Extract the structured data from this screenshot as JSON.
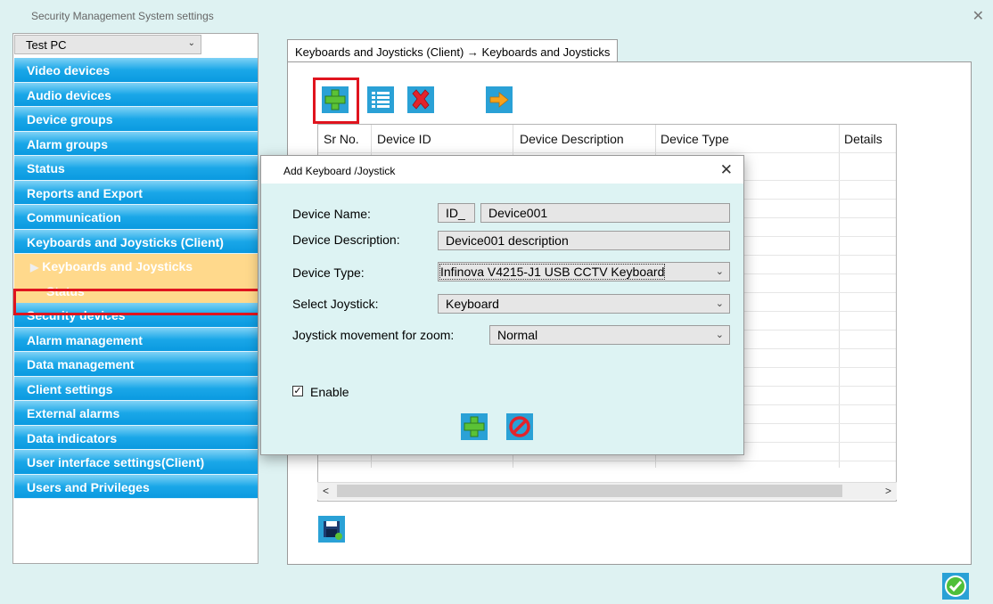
{
  "window": {
    "title": "Security Management System settings",
    "close_glyph": "✕"
  },
  "sidebar": {
    "pc_select": "Test PC",
    "items": [
      {
        "label": "Video devices"
      },
      {
        "label": "Audio devices"
      },
      {
        "label": "Device groups"
      },
      {
        "label": "Alarm groups"
      },
      {
        "label": "Status"
      },
      {
        "label": "Reports and Export"
      },
      {
        "label": "Communication"
      },
      {
        "label": "Keyboards and Joysticks (Client)"
      },
      {
        "label": "Keyboards and Joysticks"
      },
      {
        "label": "Status"
      },
      {
        "label": "Security devices"
      },
      {
        "label": "Alarm management"
      },
      {
        "label": "Data management"
      },
      {
        "label": "Client settings"
      },
      {
        "label": "External alarms"
      },
      {
        "label": "Data indicators"
      },
      {
        "label": "User interface settings(Client)"
      },
      {
        "label": "Users and Privileges"
      }
    ],
    "selected_index": 8
  },
  "main": {
    "tab_label": "Keyboards and Joysticks (Client) → Keyboards and Joysticks",
    "toolbar": {
      "add_icon": "add-icon",
      "list_icon": "list-icon",
      "delete_icon": "delete-icon",
      "move_icon": "arrow-right-icon"
    },
    "table": {
      "columns": [
        "Sr No.",
        "Device ID",
        "Device Description",
        "Device Type",
        "Details"
      ]
    }
  },
  "dialog": {
    "title": "Add Keyboard /Joystick",
    "device_name_label": "Device Name:",
    "device_name_prefix": "ID_",
    "device_name_value": "Device001",
    "device_description_label": "Device Description:",
    "device_description_value": "Device001 description",
    "device_type_label": "Device Type:",
    "device_type_value": "Infinova V4215-J1 USB CCTV Keyboard",
    "select_joystick_label": "Select Joystick:",
    "select_joystick_value": "Keyboard",
    "joystick_zoom_label": "Joystick movement for zoom:",
    "joystick_zoom_value": "Normal",
    "enable_label": "Enable",
    "enable_checked": true
  },
  "colors": {
    "background": "#def2f2",
    "nav_blue": "#1aa7e8",
    "nav_sub": "#ffd98c",
    "highlight_red": "#e0141e",
    "add_green": "#37b24d"
  }
}
